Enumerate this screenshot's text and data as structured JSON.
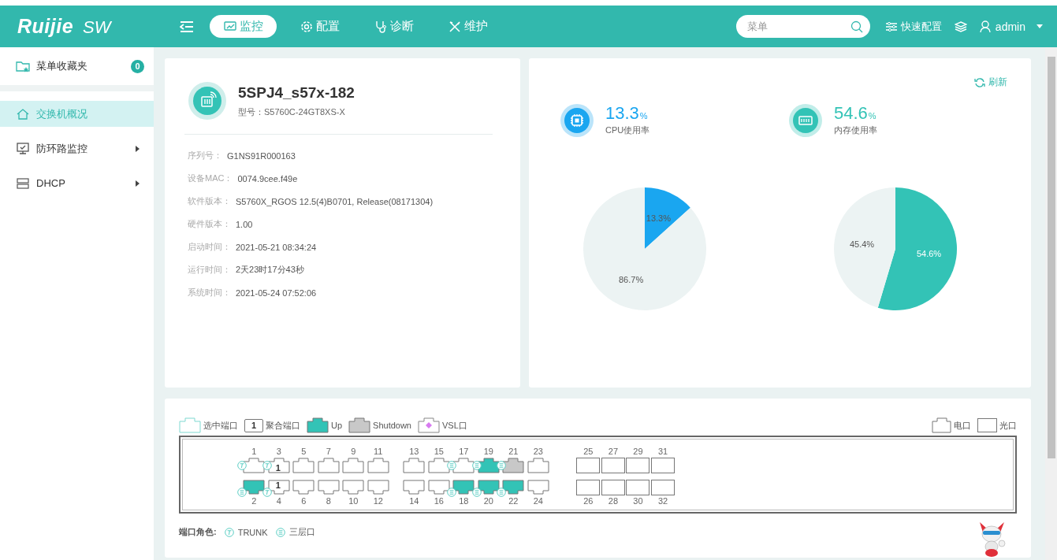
{
  "header": {
    "logo": "Ruijie",
    "product": "SW",
    "tabs": [
      {
        "label": "监控",
        "selected": true
      },
      {
        "label": "配置",
        "selected": false
      },
      {
        "label": "诊断",
        "selected": false
      },
      {
        "label": "维护",
        "selected": false
      }
    ],
    "search": {
      "placeholder": "菜单"
    },
    "quick_config": "快速配置",
    "user": "admin"
  },
  "sidebar": {
    "favorites": {
      "label": "菜单收藏夹",
      "count": "0"
    },
    "items": [
      {
        "label": "交换机概况",
        "selected": true,
        "has_submenu": false
      },
      {
        "label": "防环路监控",
        "selected": false,
        "has_submenu": true
      },
      {
        "label": "DHCP",
        "selected": false,
        "has_submenu": true
      }
    ]
  },
  "device": {
    "name": "5SPJ4_s57x-182",
    "model": "型号：S5760C-24GT8XS-X",
    "fields": [
      {
        "label": "序列号：",
        "value": "G1NS91R000163"
      },
      {
        "label": "设备MAC：",
        "value": "0074.9cee.f49e"
      },
      {
        "label": "软件版本：",
        "value": "S5760X_RGOS 12.5(4)B0701, Release(08171304)"
      },
      {
        "label": "硬件版本：",
        "value": "1.00"
      },
      {
        "label": "启动时间：",
        "value": "2021-05-21 08:34:24"
      },
      {
        "label": "运行时间：",
        "value": "2天23时17分43秒"
      },
      {
        "label": "系统时间：",
        "value": "2021-05-24 07:52:06"
      }
    ]
  },
  "usage": {
    "refresh": "刷新",
    "metrics": [
      {
        "kind": "cpu",
        "value": "13.3",
        "unit": "%",
        "label": "CPU使用率",
        "color": "#1aa6f0",
        "chart_data": {
          "type": "pie",
          "values": [
            13.3,
            86.7
          ],
          "data_labels": true,
          "value_labels": [
            "13.3%",
            "86.7%"
          ]
        }
      },
      {
        "kind": "memory",
        "value": "54.6",
        "unit": "%",
        "label": "内存使用率",
        "color": "#33c3b6",
        "chart_data": {
          "type": "pie",
          "values": [
            54.6,
            45.4
          ],
          "data_labels": true,
          "value_labels": [
            "54.6%",
            "45.4%"
          ]
        }
      }
    ]
  },
  "ports": {
    "legend": [
      {
        "kind": "selected",
        "label": "选中端口"
      },
      {
        "kind": "aggregate",
        "badge": "1",
        "label": "聚合端口"
      },
      {
        "kind": "up",
        "label": "Up"
      },
      {
        "kind": "shutdown",
        "label": "Shutdown"
      },
      {
        "kind": "vsl",
        "label": "VSL口"
      }
    ],
    "type_legend": [
      {
        "kind": "electric",
        "label": "电口"
      },
      {
        "kind": "optical",
        "label": "光口"
      }
    ],
    "groups": [
      {
        "ports": [
          {
            "number": "1",
            "kind": "electric",
            "up": false,
            "shutdown": false,
            "trunk": true,
            "layer3": false
          },
          {
            "number": "2",
            "kind": "electric",
            "up": true,
            "shutdown": false,
            "trunk": false,
            "layer3": true
          },
          {
            "number": "3",
            "kind": "electric",
            "up": false,
            "shutdown": false,
            "trunk": true,
            "layer3": false,
            "agg": "1"
          },
          {
            "number": "4",
            "kind": "electric",
            "up": false,
            "shutdown": false,
            "trunk": true,
            "layer3": false,
            "agg": "1"
          },
          {
            "number": "5",
            "kind": "electric",
            "up": false,
            "shutdown": false,
            "trunk": false,
            "layer3": false
          },
          {
            "number": "6",
            "kind": "electric",
            "up": false,
            "shutdown": false,
            "trunk": false,
            "layer3": false
          },
          {
            "number": "7",
            "kind": "electric",
            "up": false,
            "shutdown": false,
            "trunk": false,
            "layer3": false
          },
          {
            "number": "8",
            "kind": "electric",
            "up": false,
            "shutdown": false,
            "trunk": false,
            "layer3": false
          },
          {
            "number": "9",
            "kind": "electric",
            "up": false,
            "shutdown": false,
            "trunk": false,
            "layer3": false
          },
          {
            "number": "10",
            "kind": "electric",
            "up": false,
            "shutdown": false,
            "trunk": false,
            "layer3": false
          },
          {
            "number": "11",
            "kind": "electric",
            "up": false,
            "shutdown": false,
            "trunk": false,
            "layer3": false
          },
          {
            "number": "12",
            "kind": "electric",
            "up": false,
            "shutdown": false,
            "trunk": false,
            "layer3": false
          }
        ]
      },
      {
        "ports": [
          {
            "number": "13",
            "kind": "electric",
            "up": false,
            "shutdown": false,
            "trunk": false,
            "layer3": false
          },
          {
            "number": "14",
            "kind": "electric",
            "up": false,
            "shutdown": false,
            "trunk": false,
            "layer3": false
          },
          {
            "number": "15",
            "kind": "electric",
            "up": false,
            "shutdown": false,
            "trunk": false,
            "layer3": false
          },
          {
            "number": "16",
            "kind": "electric",
            "up": false,
            "shutdown": false,
            "trunk": false,
            "layer3": false
          },
          {
            "number": "17",
            "kind": "electric",
            "up": false,
            "shutdown": false,
            "trunk": false,
            "layer3": true
          },
          {
            "number": "18",
            "kind": "electric",
            "up": true,
            "shutdown": false,
            "trunk": false,
            "layer3": true
          },
          {
            "number": "19",
            "kind": "electric",
            "up": true,
            "shutdown": false,
            "trunk": false,
            "layer3": true
          },
          {
            "number": "20",
            "kind": "electric",
            "up": true,
            "shutdown": false,
            "trunk": false,
            "layer3": true
          },
          {
            "number": "21",
            "kind": "electric",
            "up": false,
            "shutdown": true,
            "trunk": false,
            "layer3": true
          },
          {
            "number": "22",
            "kind": "electric",
            "up": true,
            "shutdown": false,
            "trunk": false,
            "layer3": true
          },
          {
            "number": "23",
            "kind": "electric",
            "up": false,
            "shutdown": false,
            "trunk": false,
            "layer3": false
          },
          {
            "number": "24",
            "kind": "electric",
            "up": false,
            "shutdown": false,
            "trunk": false,
            "layer3": false
          }
        ]
      },
      {
        "ports": [
          {
            "number": "25",
            "kind": "optical",
            "up": false,
            "shutdown": false
          },
          {
            "number": "26",
            "kind": "optical",
            "up": false,
            "shutdown": false
          },
          {
            "number": "27",
            "kind": "optical",
            "up": false,
            "shutdown": false
          },
          {
            "number": "28",
            "kind": "optical",
            "up": false,
            "shutdown": false
          },
          {
            "number": "29",
            "kind": "optical",
            "up": false,
            "shutdown": false
          },
          {
            "number": "30",
            "kind": "optical",
            "up": false,
            "shutdown": false
          },
          {
            "number": "31",
            "kind": "optical",
            "up": false,
            "shutdown": false
          },
          {
            "number": "32",
            "kind": "optical",
            "up": false,
            "shutdown": false
          }
        ]
      }
    ],
    "roles_title": "端口角色:",
    "roles": [
      {
        "kind": "trunk",
        "label": "TRUNK"
      },
      {
        "kind": "l3",
        "label": "三层口"
      }
    ]
  }
}
